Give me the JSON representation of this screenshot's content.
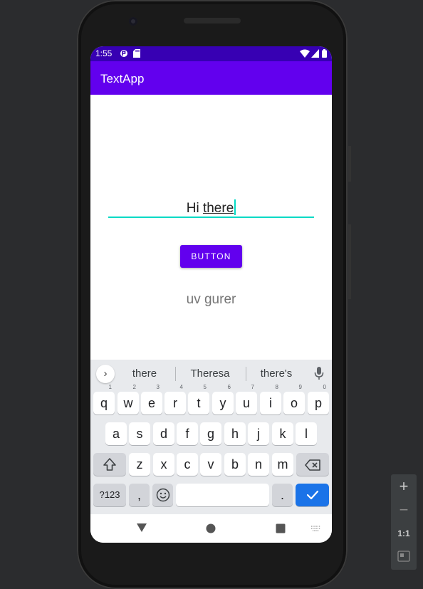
{
  "status_bar": {
    "time": "1:55",
    "color": "#3700b3"
  },
  "app_bar": {
    "title": "TextApp",
    "color": "#6200ee"
  },
  "edit_text": {
    "value_plain": "Hi ",
    "value_composing": "there",
    "accent": "#03dac5"
  },
  "button": {
    "label": "BUTTON"
  },
  "output_text": {
    "value": "uv gurer"
  },
  "keyboard": {
    "suggestions": [
      "there",
      "Theresa",
      "there's"
    ],
    "row1": [
      {
        "k": "q",
        "h": "1"
      },
      {
        "k": "w",
        "h": "2"
      },
      {
        "k": "e",
        "h": "3"
      },
      {
        "k": "r",
        "h": "4"
      },
      {
        "k": "t",
        "h": "5"
      },
      {
        "k": "y",
        "h": "6"
      },
      {
        "k": "u",
        "h": "7"
      },
      {
        "k": "i",
        "h": "8"
      },
      {
        "k": "o",
        "h": "9"
      },
      {
        "k": "p",
        "h": "0"
      }
    ],
    "row2": [
      "a",
      "s",
      "d",
      "f",
      "g",
      "h",
      "j",
      "k",
      "l"
    ],
    "row3": [
      "z",
      "x",
      "c",
      "v",
      "b",
      "n",
      "m"
    ],
    "symbols_label": "?123",
    "comma_label": ",",
    "period_label": ".",
    "enter_color": "#1a73e8"
  },
  "emulator_zoom": {
    "fit_label": "1:1"
  }
}
